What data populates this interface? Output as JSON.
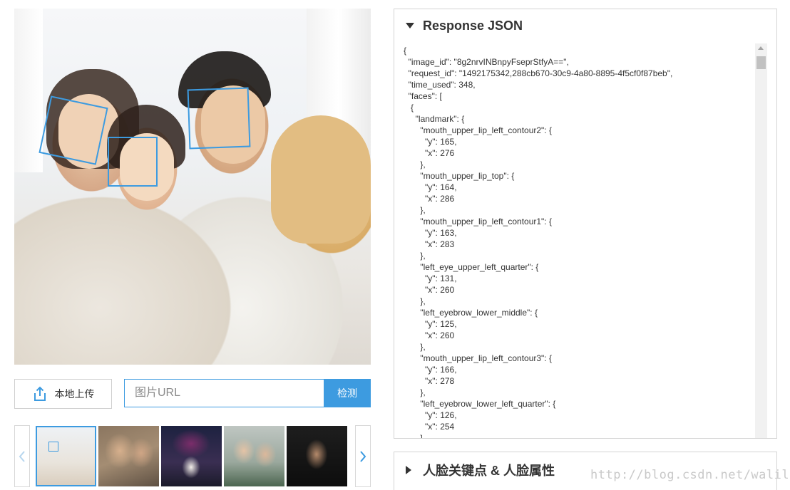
{
  "photo": {
    "alt": "family-photo"
  },
  "controls": {
    "upload_label": "本地上传",
    "url_placeholder": "图片URL",
    "detect_label": "检测"
  },
  "thumbnails": {
    "left_arrow": "‹",
    "right_arrow": "›"
  },
  "json_panel": {
    "title": "Response JSON",
    "lines": [
      "{",
      "  \"image_id\": \"8g2nrvINBnpyFseprStfyA==\",",
      "  \"request_id\": \"1492175342,288cb670-30c9-4a80-8895-4f5cf0f87beb\",",
      "  \"time_used\": 348,",
      "  \"faces\": [",
      "   {",
      "     \"landmark\": {",
      "       \"mouth_upper_lip_left_contour2\": {",
      "         \"y\": 165,",
      "         \"x\": 276",
      "       },",
      "       \"mouth_upper_lip_top\": {",
      "         \"y\": 164,",
      "         \"x\": 286",
      "       },",
      "       \"mouth_upper_lip_left_contour1\": {",
      "         \"y\": 163,",
      "         \"x\": 283",
      "       },",
      "       \"left_eye_upper_left_quarter\": {",
      "         \"y\": 131,",
      "         \"x\": 260",
      "       },",
      "       \"left_eyebrow_lower_middle\": {",
      "         \"y\": 125,",
      "         \"x\": 260",
      "       },",
      "       \"mouth_upper_lip_left_contour3\": {",
      "         \"y\": 166,",
      "         \"x\": 278",
      "       },",
      "       \"left_eyebrow_lower_left_quarter\": {",
      "         \"y\": 126,",
      "         \"x\": 254",
      "       }"
    ]
  },
  "attr_panel": {
    "title": "人脸关键点 & 人脸属性"
  },
  "watermark": "http://blog.csdn.net/walilk",
  "colors": {
    "accent": "#3d9be0",
    "border": "#d4d4d4"
  }
}
